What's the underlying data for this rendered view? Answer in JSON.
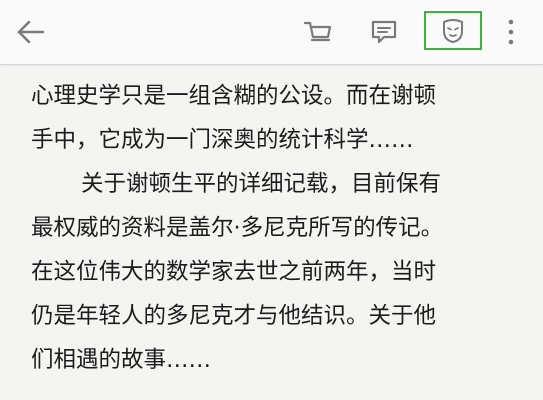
{
  "toolbar": {
    "icons": [
      "back-arrow-icon",
      "cart-icon",
      "notes-icon",
      "theme-mask-icon",
      "more-vertical-icon"
    ],
    "icon_color": "#7a7a7a",
    "highlight_color": "#3eb33e"
  },
  "content": {
    "lines": [
      "心理史学只是一组含糊的公设。而在谢顿",
      "手中，它成为一门深奥的统计科学……",
      "关于谢顿生平的详细记载，目前保有",
      "最权威的资料是盖尔·多尼克所写的传记。",
      "在这位伟大的数学家去世之前两年，当时",
      "仍是年轻人的多尼克才与他结识。关于他",
      "们相遇的故事……"
    ]
  }
}
